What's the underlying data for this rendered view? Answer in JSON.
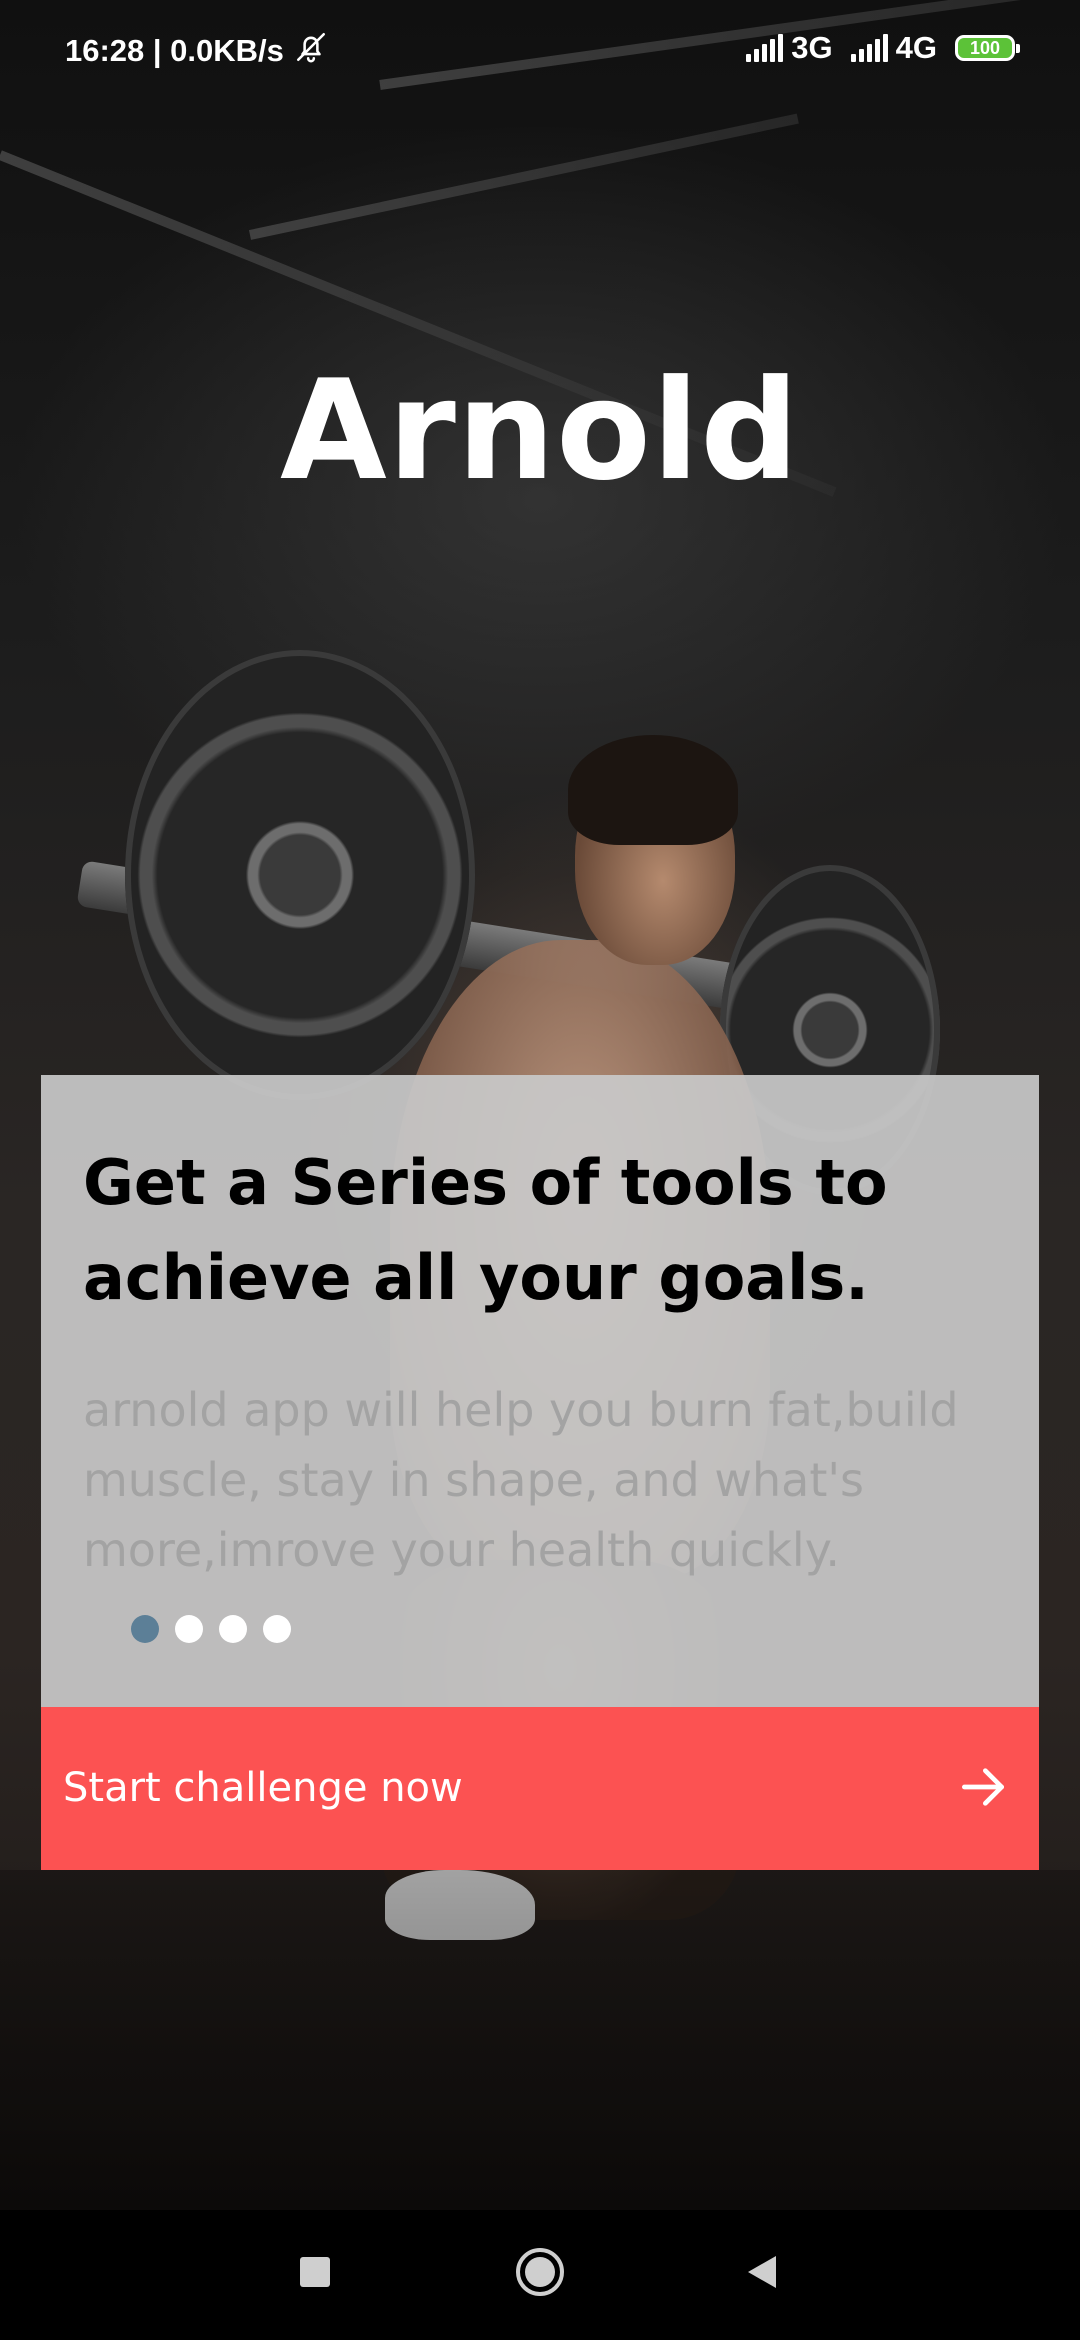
{
  "status_bar": {
    "time_speed": "16:28 | 0.0KB/s",
    "mute_icon": "bell-off-icon",
    "network_1": "3G",
    "network_2": "4G",
    "battery": "100",
    "battery_color": "#5cc238"
  },
  "app": {
    "title": "Arnold"
  },
  "onboarding": {
    "heading": "Get a Series of tools to achieve all your goals.",
    "description": "arnold app will help you burn fat,build muscle, stay in shape, and what's more,imrove your health quickly.",
    "page_indicator": {
      "total": 4,
      "active_index": 0,
      "active_color": "#5c7f97",
      "inactive_color": "#ffffff"
    }
  },
  "cta": {
    "label": "Start challenge now",
    "icon": "arrow-right-icon",
    "color": "#fc5252"
  },
  "nav_bar": {
    "recent_icon": "square-icon",
    "home_icon": "circle-icon",
    "back_icon": "triangle-back-icon"
  }
}
